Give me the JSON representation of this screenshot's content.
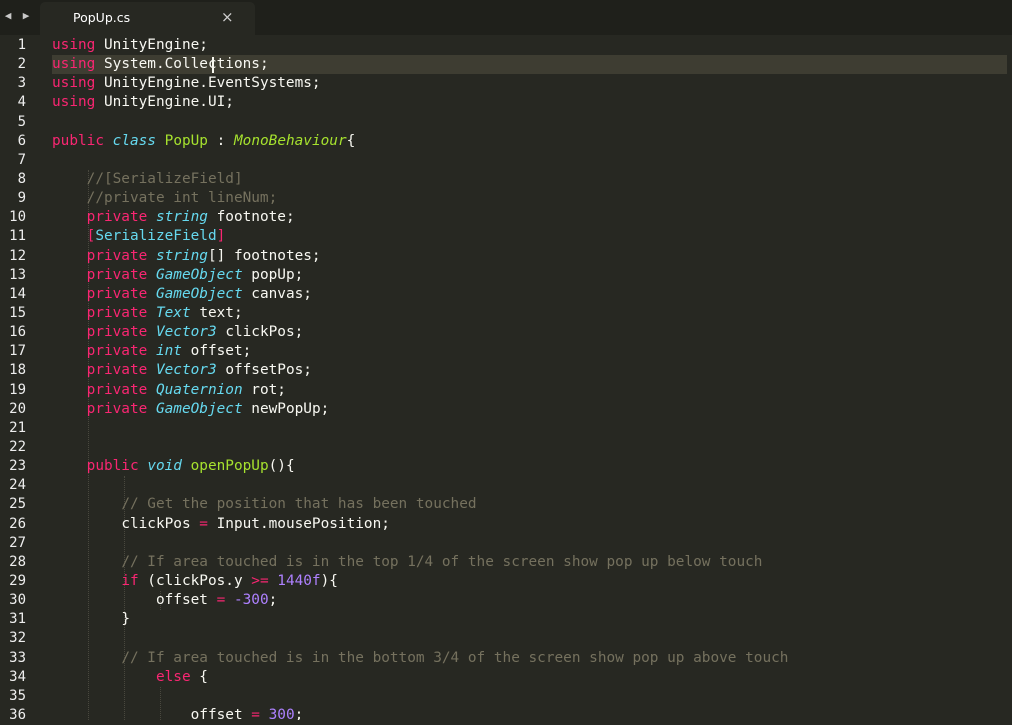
{
  "tab": {
    "filename": "PopUp.cs",
    "close_glyph": "×"
  },
  "nav": {
    "back_glyph": "◀",
    "forward_glyph": "▶"
  },
  "line_numbers": [
    "1",
    "2",
    "3",
    "4",
    "5",
    "6",
    "7",
    "8",
    "9",
    "10",
    "11",
    "12",
    "13",
    "14",
    "15",
    "16",
    "17",
    "18",
    "19",
    "20",
    "21",
    "22",
    "23",
    "24",
    "25",
    "26",
    "27",
    "28",
    "29",
    "30",
    "31",
    "32",
    "33",
    "34",
    "35",
    "36"
  ],
  "code": {
    "l1": [
      "using",
      " UnityEngine;"
    ],
    "l2a": [
      "using",
      " System.Coll"
    ],
    "l2b": "ections;",
    "l3": [
      "using",
      " UnityEngine.EventSystems;"
    ],
    "l4": [
      "using",
      " UnityEngine.UI;"
    ],
    "l6": [
      "public",
      "class",
      "PopUp",
      ":",
      "MonoBehaviour",
      "{"
    ],
    "l8": "//[SerializeField]",
    "l9": "//private int lineNum;",
    "l10": [
      "private",
      "string",
      "footnote;"
    ],
    "l11": "[SerializeField]",
    "l12": [
      "private",
      "string",
      "[] footnotes;"
    ],
    "l13": [
      "private",
      "GameObject",
      "popUp;"
    ],
    "l14": [
      "private",
      "GameObject",
      "canvas;"
    ],
    "l15": [
      "private",
      "Text",
      "text;"
    ],
    "l16": [
      "private",
      "Vector3",
      "clickPos;"
    ],
    "l17": [
      "private",
      "int",
      "offset;"
    ],
    "l18": [
      "private",
      "Vector3",
      "offsetPos;"
    ],
    "l19": [
      "private",
      "Quaternion",
      "rot;"
    ],
    "l20": [
      "private",
      "GameObject",
      "newPopUp;"
    ],
    "l23": [
      "public",
      "void",
      "openPopUp",
      "(){"
    ],
    "l25": "// Get the position that has been touched",
    "l26": [
      "clickPos ",
      "=",
      " Input.mousePosition;"
    ],
    "l28": "// If area touched is in the top 1/4 of the screen show pop up below touch",
    "l29": [
      "if",
      " (clickPos.y ",
      ">=",
      " ",
      "1440f",
      "){"
    ],
    "l30": [
      "offset ",
      "=",
      " ",
      "-300",
      ";"
    ],
    "l31": "}",
    "l33": "// If area touched is in the bottom 3/4 of the screen show pop up above touch",
    "l34": [
      "else",
      " {"
    ],
    "l36": [
      "offset ",
      "=",
      " ",
      "300",
      ";"
    ]
  }
}
